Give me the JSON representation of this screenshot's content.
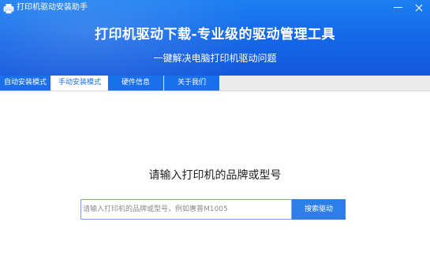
{
  "window": {
    "title": "打印机驱动安装助手",
    "minimize_icon": "minimize-icon",
    "close_icon": "close-icon"
  },
  "banner": {
    "headline": "打印机驱动下载-专业级的驱动管理工具",
    "subheadline": "一键解决电脑打印机驱动问题"
  },
  "tabs": [
    {
      "label": "自动安装模式",
      "active": false
    },
    {
      "label": "手动安装模式",
      "active": true
    },
    {
      "label": "硬件信息",
      "active": false
    },
    {
      "label": "关于我们",
      "active": false
    }
  ],
  "main": {
    "prompt": "请输入打印机的品牌或型号",
    "search": {
      "value": "",
      "placeholder": "请输入打印机的品牌或型号，例如惠普M1005",
      "button_label": "搜索驱动"
    }
  },
  "colors": {
    "brand_blue": "#1466e6",
    "tab_blue": "#1a6fea",
    "button_blue": "#2d7ee6"
  }
}
